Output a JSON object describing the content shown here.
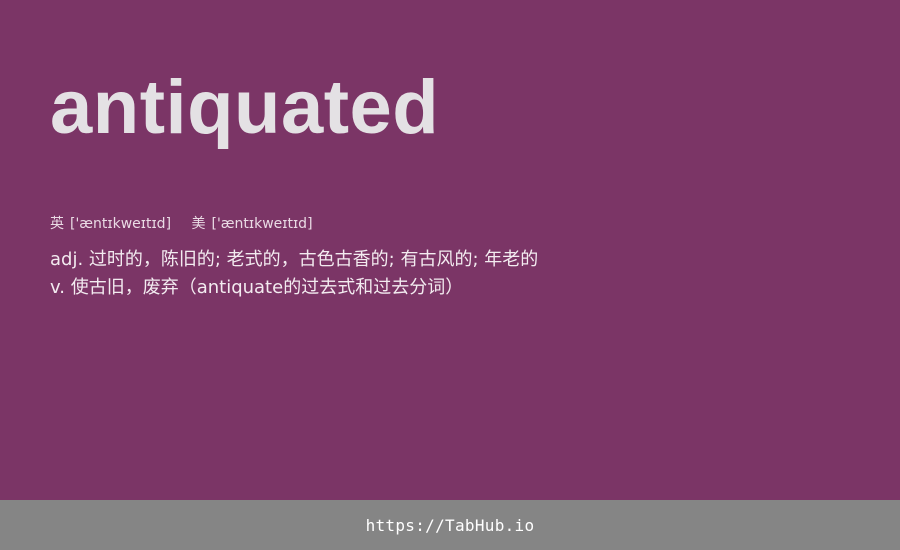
{
  "card": {
    "word": "antiquated",
    "phonetics": {
      "uk_label": "英",
      "uk": "['æntɪkweɪtɪd]",
      "us_label": "美",
      "us": "['æntɪkweɪtɪd]"
    },
    "definitions": [
      "adj. 过时的，陈旧的; 老式的，古色古香的; 有古风的; 年老的",
      "v. 使古旧，废弃（antiquate的过去式和过去分词）"
    ]
  },
  "footer": {
    "link_text": "https://TabHub.io"
  },
  "colors": {
    "background": "#7b3566",
    "word": "#e4e1e4",
    "footer_background": "#858585",
    "footer_text": "#ffffff"
  }
}
